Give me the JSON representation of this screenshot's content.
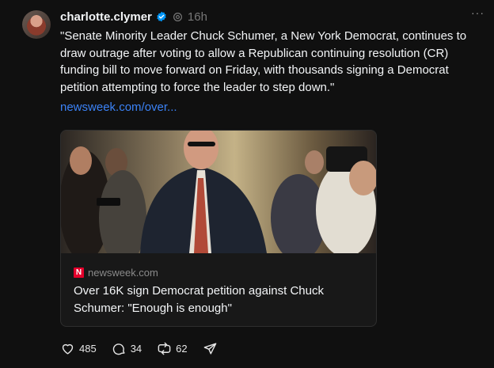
{
  "post": {
    "username": "charlotte.clymer",
    "time": "16h",
    "more_label": "···",
    "text": "\"Senate Minority Leader Chuck Schumer, a New York Democrat, continues to draw outrage after voting to allow a Republican continuing resolution (CR) funding bill to move forward on Friday, with thousands signing a Democrat petition attempting to force the leader to step down.\"",
    "link": "newsweek.com/over..."
  },
  "card": {
    "logo_letter": "N",
    "domain": "newsweek.com",
    "title": "Over 16K sign Democrat petition against Chuck Schumer: \"Enough is enough\""
  },
  "actions": {
    "likes": "485",
    "replies": "34",
    "reposts": "62"
  },
  "colors": {
    "background": "#101010",
    "link": "#3b82f6",
    "verified": "#0095f6",
    "newsweek_red": "#e4002b"
  },
  "icons": [
    "verified-badge-icon",
    "threads-icon",
    "more-icon",
    "heart-icon",
    "comment-icon",
    "repost-icon",
    "share-icon"
  ]
}
